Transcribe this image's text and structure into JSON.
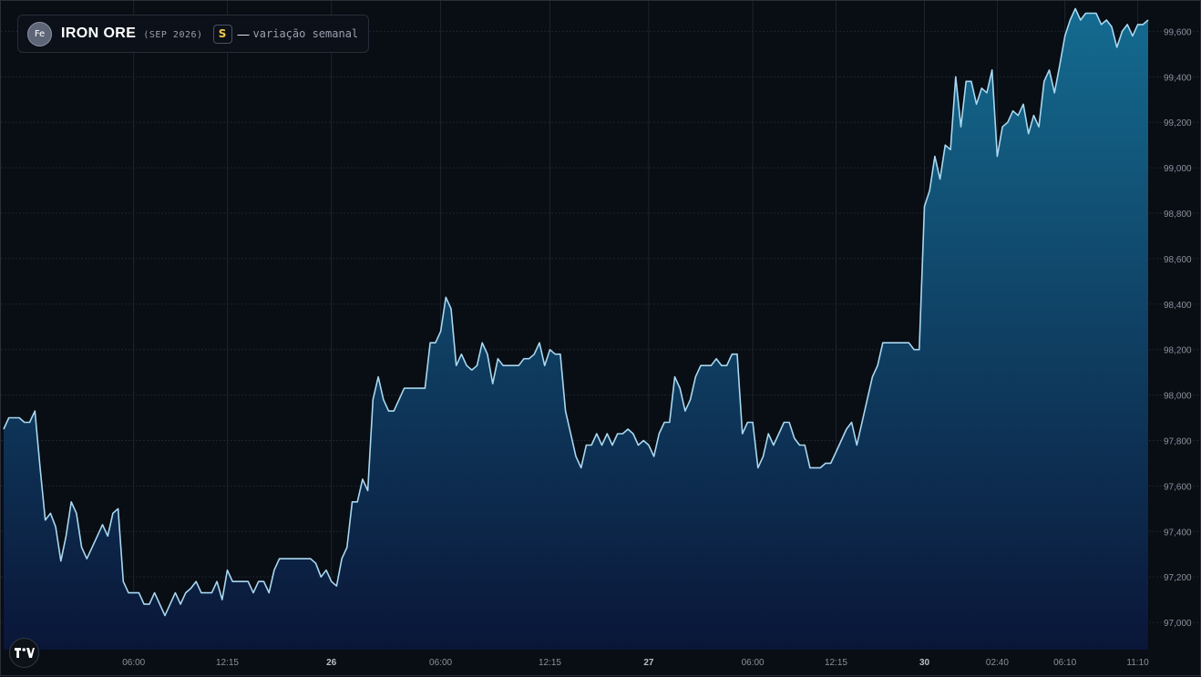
{
  "legend": {
    "icon_text": "Fe",
    "symbol": "IRON ORE",
    "contract": "(SEP 2026)",
    "badge": "S",
    "separator": "—",
    "description": "variação semanal"
  },
  "colors": {
    "background": "#090d14",
    "line": "#a7d8f0",
    "area_top": "#146b90",
    "area_bottom": "#0a1638",
    "grid": "#1e2430",
    "axis_text": "#8a909c",
    "badge_text": "#f2c94c"
  },
  "chart_data": {
    "type": "area",
    "title": "IRON ORE (SEP 2026)",
    "subtitle": "variação semanal",
    "grid": true,
    "legend_position": "top-left",
    "ylim": [
      96880,
      99730
    ],
    "y_ticks": [
      97000,
      97200,
      97400,
      97600,
      97800,
      98000,
      98200,
      98400,
      98600,
      98800,
      99000,
      99200,
      99400,
      99600
    ],
    "y_tick_labels": [
      "97,000",
      "97,200",
      "97,400",
      "97,600",
      "97,800",
      "98,000",
      "98,200",
      "98,400",
      "98,600",
      "98,800",
      "99,000",
      "99,200",
      "99,400",
      "99,600"
    ],
    "x_ticks": [
      {
        "label": "06:00",
        "index": 25,
        "bold": false
      },
      {
        "label": "12:15",
        "index": 43,
        "bold": false
      },
      {
        "label": "26",
        "index": 63,
        "bold": true
      },
      {
        "label": "06:00",
        "index": 84,
        "bold": false
      },
      {
        "label": "12:15",
        "index": 105,
        "bold": false
      },
      {
        "label": "27",
        "index": 124,
        "bold": true
      },
      {
        "label": "06:00",
        "index": 144,
        "bold": false
      },
      {
        "label": "12:15",
        "index": 160,
        "bold": false
      },
      {
        "label": "30",
        "index": 177,
        "bold": true
      },
      {
        "label": "02:40",
        "index": 191,
        "bold": false
      },
      {
        "label": "06:10",
        "index": 204,
        "bold": false
      },
      {
        "label": "11:10",
        "index": 218,
        "bold": false
      }
    ],
    "series": [
      {
        "values": [
          97850,
          97900,
          97900,
          97900,
          97880,
          97880,
          97930,
          97680,
          97450,
          97480,
          97420,
          97270,
          97380,
          97530,
          97480,
          97330,
          97280,
          97330,
          97380,
          97430,
          97380,
          97480,
          97500,
          97180,
          97130,
          97130,
          97130,
          97080,
          97080,
          97130,
          97080,
          97030,
          97080,
          97130,
          97080,
          97130,
          97150,
          97180,
          97130,
          97130,
          97130,
          97180,
          97100,
          97230,
          97180,
          97180,
          97180,
          97180,
          97130,
          97180,
          97180,
          97130,
          97230,
          97280,
          97280,
          97280,
          97280,
          97280,
          97280,
          97280,
          97260,
          97200,
          97230,
          97180,
          97160,
          97280,
          97330,
          97530,
          97530,
          97630,
          97580,
          97980,
          98080,
          97980,
          97930,
          97930,
          97980,
          98030,
          98030,
          98030,
          98030,
          98030,
          98230,
          98230,
          98280,
          98430,
          98380,
          98130,
          98180,
          98130,
          98110,
          98130,
          98230,
          98180,
          98050,
          98160,
          98130,
          98130,
          98130,
          98130,
          98160,
          98160,
          98180,
          98230,
          98130,
          98200,
          98180,
          98180,
          97930,
          97830,
          97730,
          97680,
          97780,
          97780,
          97830,
          97780,
          97830,
          97780,
          97830,
          97830,
          97850,
          97830,
          97780,
          97800,
          97780,
          97730,
          97830,
          97880,
          97880,
          98080,
          98030,
          97930,
          97980,
          98080,
          98130,
          98130,
          98130,
          98160,
          98130,
          98130,
          98180,
          98180,
          97830,
          97880,
          97880,
          97680,
          97730,
          97830,
          97780,
          97830,
          97880,
          97880,
          97810,
          97780,
          97780,
          97680,
          97680,
          97680,
          97700,
          97700,
          97750,
          97800,
          97850,
          97880,
          97780,
          97880,
          97980,
          98080,
          98130,
          98230,
          98230,
          98230,
          98230,
          98230,
          98230,
          98200,
          98200,
          98830,
          98900,
          99050,
          98950,
          99100,
          99080,
          99400,
          99180,
          99380,
          99380,
          99280,
          99350,
          99330,
          99430,
          99050,
          99180,
          99200,
          99250,
          99230,
          99280,
          99150,
          99230,
          99180,
          99380,
          99430,
          99330,
          99450,
          99580,
          99650,
          99700,
          99650,
          99680,
          99680,
          99680,
          99630,
          99650,
          99620,
          99530,
          99600,
          99630,
          99580,
          99630,
          99630,
          99650
        ]
      }
    ]
  }
}
